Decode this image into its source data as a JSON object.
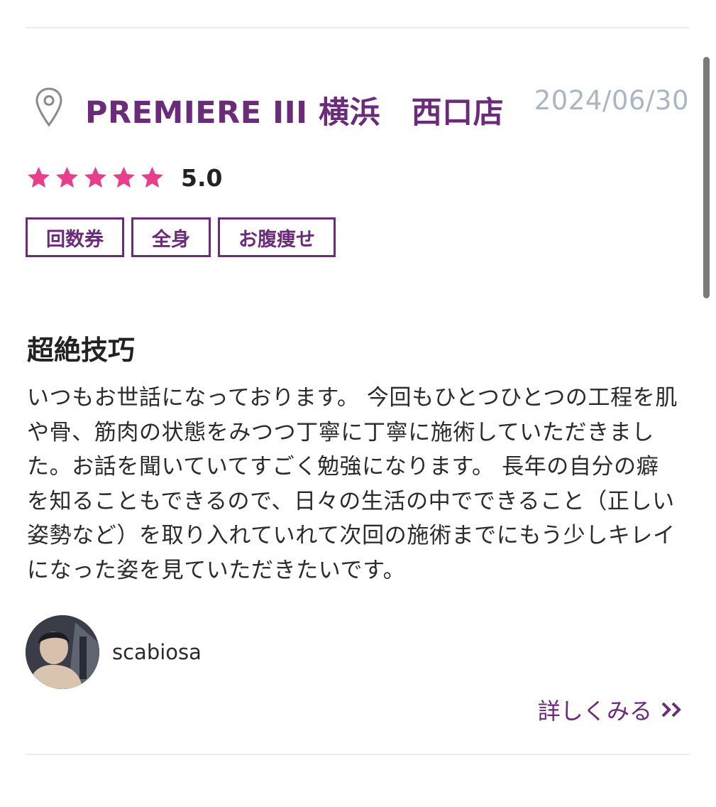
{
  "review": {
    "shop_name": "PREMIERE III 横浜　西口店",
    "date": "2024/06/30",
    "rating": 5,
    "rating_label": "5.0",
    "tags": [
      "回数券",
      "全身",
      "お腹痩せ"
    ],
    "title": "超絶技巧",
    "body": "いつもお世話になっております。 今回もひとつひとつの工程を肌や骨、筋肉の状態をみつつ丁寧に丁寧に施術していただきました。お話を聞いていてすごく勉強になります。 長年の自分の癖を知ることもできるので、日々の生活の中でできること（正しい姿勢など）を取り入れていれて次回の施術までにもう少しキレイになった姿を見ていただきたいです。",
    "author": "scabiosa",
    "more_label": "詳しくみる"
  },
  "icons": {
    "location": "map-pin-icon",
    "star": "star-icon",
    "more": "double-chevron-right-icon"
  },
  "colors": {
    "accent": "#6b2a7a",
    "star": "#e83e8c",
    "date": "#a9b6c4",
    "text": "#2b2b2b"
  }
}
